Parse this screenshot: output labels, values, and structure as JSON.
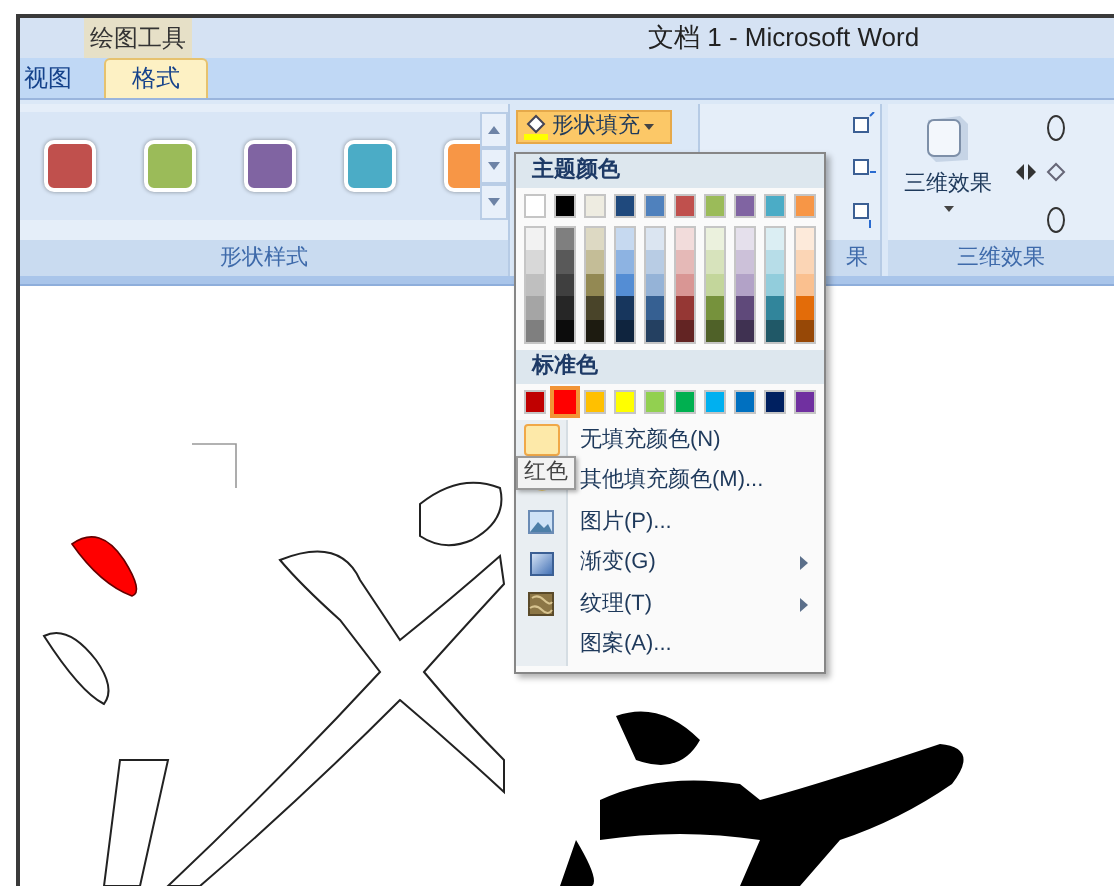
{
  "window": {
    "title": "文档 1 - Microsoft Word",
    "context_tab": "绘图工具"
  },
  "tabs": [
    {
      "label": "视图",
      "selected": false
    },
    {
      "label": "格式",
      "selected": true
    }
  ],
  "ribbon": {
    "shape_styles": {
      "label": "形状样式",
      "swatches": [
        {
          "color": "#c0504d"
        },
        {
          "color": "#9bbb59"
        },
        {
          "color": "#8064a2"
        },
        {
          "color": "#4bacc6"
        },
        {
          "color": "#f79646"
        }
      ]
    },
    "fill_button": {
      "label": "形状填充"
    },
    "shadow_group": {
      "label": "果"
    },
    "three_d": {
      "button": "三维效果",
      "label": "三维效果"
    }
  },
  "fill_menu": {
    "theme_header": "主题颜色",
    "theme_colors": [
      {
        "color": "#ffffff",
        "shades": [
          {
            "color": "#f2f2f2"
          },
          {
            "color": "#d8d8d8"
          },
          {
            "color": "#bfbfbf"
          },
          {
            "color": "#a5a5a5"
          },
          {
            "color": "#7f7f7f"
          }
        ]
      },
      {
        "color": "#000000",
        "shades": [
          {
            "color": "#7f7f7f"
          },
          {
            "color": "#595959"
          },
          {
            "color": "#3f3f3f"
          },
          {
            "color": "#262626"
          },
          {
            "color": "#0c0c0c"
          }
        ]
      },
      {
        "color": "#eeece1",
        "shades": [
          {
            "color": "#ddd9c3"
          },
          {
            "color": "#c4bd97"
          },
          {
            "color": "#938953"
          },
          {
            "color": "#494429"
          },
          {
            "color": "#1d1b10"
          }
        ]
      },
      {
        "color": "#1f497d",
        "shades": [
          {
            "color": "#c6d9f0"
          },
          {
            "color": "#8db3e2"
          },
          {
            "color": "#548dd4"
          },
          {
            "color": "#17365d"
          },
          {
            "color": "#0f243e"
          }
        ]
      },
      {
        "color": "#4f81bd",
        "shades": [
          {
            "color": "#dbe5f1"
          },
          {
            "color": "#b8cce4"
          },
          {
            "color": "#95b3d7"
          },
          {
            "color": "#366092"
          },
          {
            "color": "#244061"
          }
        ]
      },
      {
        "color": "#c0504d",
        "shades": [
          {
            "color": "#f2dcdb"
          },
          {
            "color": "#e5b9b7"
          },
          {
            "color": "#d99694"
          },
          {
            "color": "#953734"
          },
          {
            "color": "#632423"
          }
        ]
      },
      {
        "color": "#9bbb59",
        "shades": [
          {
            "color": "#ebf1dd"
          },
          {
            "color": "#d7e3bc"
          },
          {
            "color": "#c3d69b"
          },
          {
            "color": "#76923c"
          },
          {
            "color": "#4f6128"
          }
        ]
      },
      {
        "color": "#8064a2",
        "shades": [
          {
            "color": "#e5e0ec"
          },
          {
            "color": "#ccc1d9"
          },
          {
            "color": "#b2a2c7"
          },
          {
            "color": "#5f497a"
          },
          {
            "color": "#3f3151"
          }
        ]
      },
      {
        "color": "#4bacc6",
        "shades": [
          {
            "color": "#dbeef3"
          },
          {
            "color": "#b7dde8"
          },
          {
            "color": "#92cddc"
          },
          {
            "color": "#31859b"
          },
          {
            "color": "#205867"
          }
        ]
      },
      {
        "color": "#f79646",
        "shades": [
          {
            "color": "#fdeada"
          },
          {
            "color": "#fbd5b5"
          },
          {
            "color": "#fac08f"
          },
          {
            "color": "#e36c09"
          },
          {
            "color": "#974806"
          }
        ]
      }
    ],
    "standard_header": "标准色",
    "standard_colors": [
      {
        "color": "#c00000",
        "selected": false
      },
      {
        "color": "#ff0000",
        "selected": true
      },
      {
        "color": "#ffc000",
        "selected": false
      },
      {
        "color": "#ffff00",
        "selected": false
      },
      {
        "color": "#92d050",
        "selected": false
      },
      {
        "color": "#00b050",
        "selected": false
      },
      {
        "color": "#00b0f0",
        "selected": false
      },
      {
        "color": "#0070c0",
        "selected": false
      },
      {
        "color": "#002060",
        "selected": false
      },
      {
        "color": "#7030a0",
        "selected": false
      }
    ],
    "items": [
      {
        "kind": "swatch",
        "label": "无填充颜色(N)",
        "submenu": false
      },
      {
        "kind": "palette",
        "label": "其他填充颜色(M)...",
        "submenu": false
      },
      {
        "kind": "picture",
        "label": "图片(P)...",
        "submenu": false
      },
      {
        "kind": "gradient",
        "label": "渐变(G)",
        "submenu": true
      },
      {
        "kind": "texture",
        "label": "纹理(T)",
        "submenu": true
      },
      {
        "kind": "none",
        "label": "图案(A)...",
        "submenu": false
      }
    ],
    "tooltip": "红色"
  }
}
